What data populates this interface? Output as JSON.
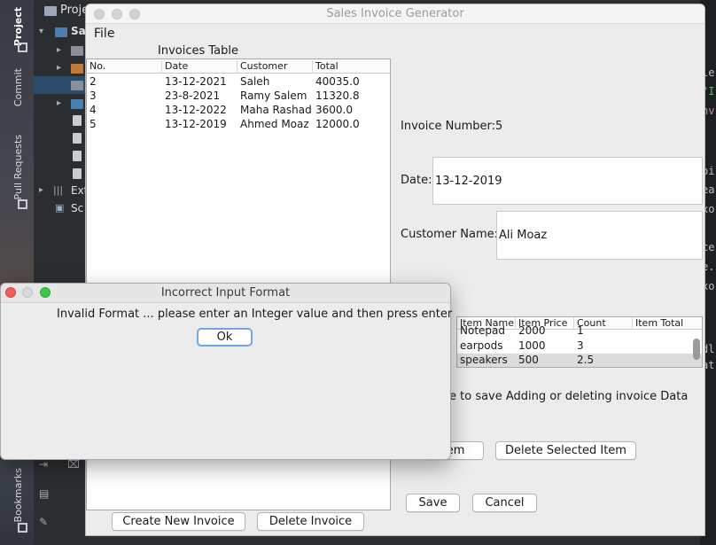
{
  "ide": {
    "project_tab": "Project",
    "commit_tab": "Commit",
    "pull_requests_tab": "Pull Requests",
    "bookmarks_tab": "Bookmarks",
    "project_header": "Proje",
    "tree_root": "Sa",
    "tree_ext": "Ext",
    "tree_sc": "Sc",
    "code_fragments": [
      "le",
      "\"I",
      "nv",
      "oi",
      "ea",
      "xo",
      "ce",
      "e.",
      "xo",
      "dl",
      "at"
    ]
  },
  "window": {
    "title": "Sales Invoice Generator"
  },
  "menu": {
    "file": "File"
  },
  "invoices": {
    "caption": "Invoices Table",
    "columns": [
      "No.",
      "Date",
      "Customer",
      "Total"
    ],
    "rows": [
      [
        "2",
        "13-12-2021",
        "Saleh",
        "40035.0"
      ],
      [
        "3",
        "23-8-2021",
        "Ramy Salem",
        "11320.8"
      ],
      [
        "4",
        "13-12-2022",
        "Maha Rashad",
        "3600.0"
      ],
      [
        "5",
        "13-12-2019",
        "Ahmed Moaz",
        "12000.0"
      ]
    ],
    "create_button": "Create New Invoice",
    "delete_button": "Delete Invoice"
  },
  "details": {
    "invoice_number_label": "Invoice Number:5",
    "date_label": "Date:",
    "date_value": "13-12-2019",
    "customer_label": "Customer Name:",
    "customer_value": "Ali Moaz"
  },
  "items": {
    "columns": [
      "Item Name",
      "Item Price",
      "Count",
      "Item Total"
    ],
    "rows": [
      [
        "Notepad",
        "2000",
        "1",
        ""
      ],
      [
        "earpods",
        "1000",
        "3",
        ""
      ],
      [
        "speakers",
        "500",
        "2.5",
        ""
      ]
    ],
    "save_hint": "e to save Adding or deleting invoice Data",
    "add_button_partial": "tem",
    "delete_item_button": "Delete Selected Item",
    "save_button": "Save",
    "cancel_button": "Cancel"
  },
  "dialog": {
    "title": "Incorrect Input Format",
    "message": "Invalid Format ... please enter an Integer value and then press enter",
    "ok_button": "Ok"
  }
}
